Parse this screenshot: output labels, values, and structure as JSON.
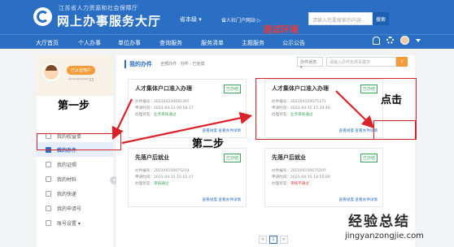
{
  "header": {
    "org_name": "江苏省人力资源和社会保障厅",
    "site_title": "网上办事服务大厅",
    "region": "省本级 ▾",
    "portal_link": "省人社门户网站 ▷",
    "search_placeholder": "请输入您要搜索的内容",
    "search_button": "搜索"
  },
  "env_tag": "测试环境",
  "nav": {
    "items": [
      "大厅首页",
      "个人办事",
      "单位办事",
      "查询服务",
      "服务清单",
      "主题服务",
      "公示公告"
    ]
  },
  "sidebar": {
    "badge": "已认证用户",
    "user_id": "**********33",
    "items": [
      "我的权益单",
      "我的办件",
      "我的证照",
      "我的材料",
      "我的快递",
      "我的申请号",
      "账号设置 ▾"
    ]
  },
  "main": {
    "title": "我的办件",
    "filter_tabs": "全部办件  ·  办件  ·  已完成",
    "select_label": "办件状态 ▾",
    "keyword_placeholder": "请输入办件名称关键字",
    "search_icon": "search-icon",
    "cards": [
      {
        "title": "人才集体户口准入办理",
        "status": "已办结",
        "number": "办件编号：202104230061397",
        "date": "申请时间：2021-04-23 09:58:17",
        "state_prefix": "办理状态：",
        "state": "业务审核通过",
        "state_kind": "ok",
        "actions": "查看进度  查看办件详情"
      },
      {
        "title": "人才集体户口准入办理",
        "status": "已办结",
        "number": "办件编号：202104150075371",
        "date": "申请时间：2021-04-15 15:30:46",
        "state_prefix": "办理状态：",
        "state": "业务审核通过",
        "state_kind": "ok",
        "actions": "查看进度  查看办件详情"
      },
      {
        "title": "先落户后就业",
        "status": "已办结",
        "number": "办件编号：202104150075214",
        "date": "申请时间：2021-04-15 15:02:17",
        "state_prefix": "办理状态：",
        "state": "审核通过",
        "state_kind": "ok",
        "actions": "查看进度  查看办件详情"
      },
      {
        "title": "先落户后就业",
        "status": "已办结",
        "number": "办件编号：202104150075197",
        "date": "申请时间：2021-04-15 14:55:00",
        "state_prefix": "办理状态：",
        "state": "审核不通过",
        "state_kind": "bad",
        "actions": "查看进度  查看办件详情"
      }
    ],
    "pager": [
      "<",
      "1",
      ">"
    ]
  },
  "annotations": {
    "step1": "第一步",
    "step2": "第二步",
    "click": "点击",
    "color": "#d9232b"
  },
  "watermark": {
    "title": "经验总结",
    "url": "jingyanzongjie.com"
  }
}
